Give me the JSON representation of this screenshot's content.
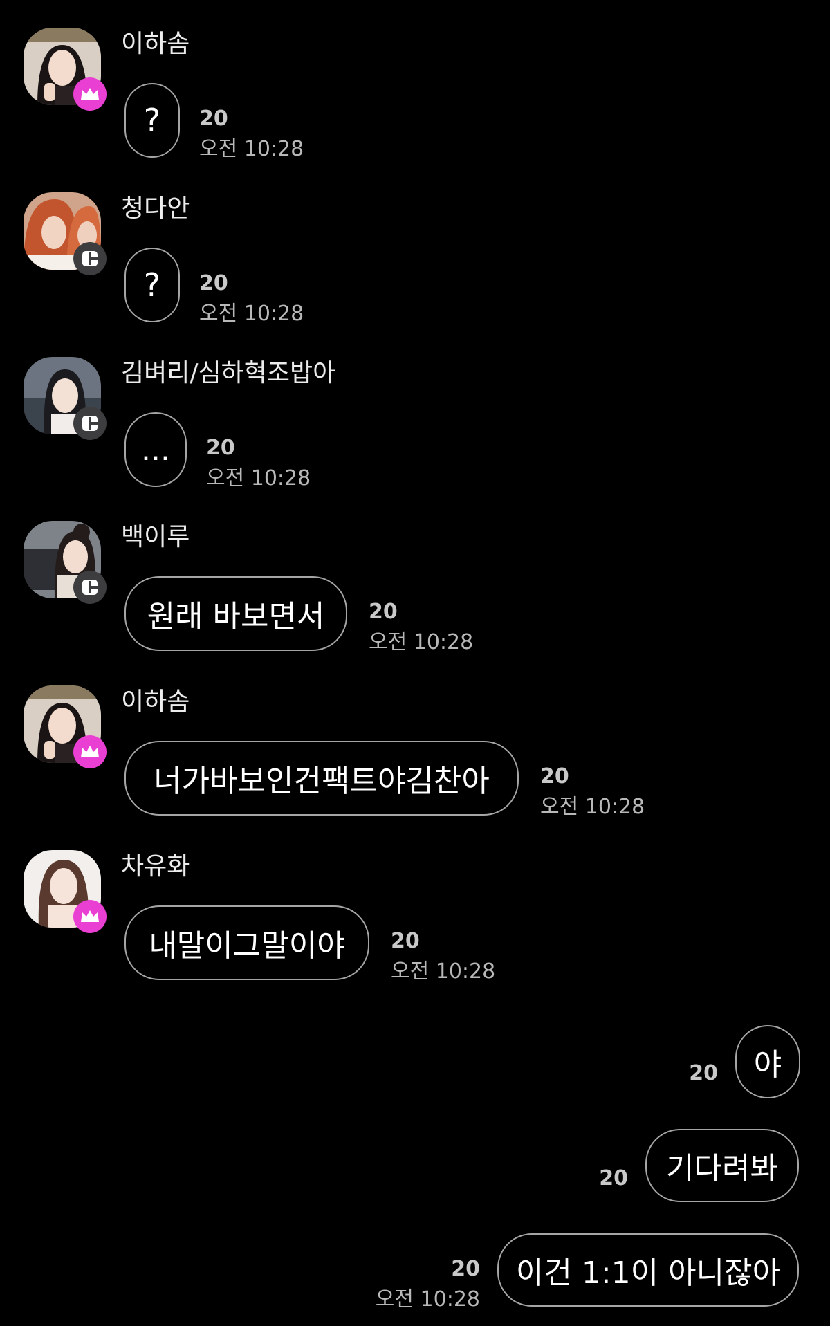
{
  "messages": [
    {
      "sender": "이하솜",
      "text": "?",
      "unread": "20",
      "time": "오전 10:28",
      "badge": "crown"
    },
    {
      "sender": "청다안",
      "text": "?",
      "unread": "20",
      "time": "오전 10:28",
      "badge": "manager"
    },
    {
      "sender": "김벼리/심하혁조밥아",
      "text": "...",
      "unread": "20",
      "time": "오전 10:28",
      "badge": "manager"
    },
    {
      "sender": "백이루",
      "text": "원래 바보면서",
      "unread": "20",
      "time": "오전 10:28",
      "badge": "manager"
    },
    {
      "sender": "이하솜",
      "text": "너가바보인건팩트야김찬아",
      "unread": "20",
      "time": "오전 10:28",
      "badge": "crown"
    },
    {
      "sender": "차유화",
      "text": "내말이그말이야",
      "unread": "20",
      "time": "오전 10:28",
      "badge": "crown"
    }
  ],
  "my_messages": [
    {
      "text": "야",
      "unread": "20"
    },
    {
      "text": "기다려봐",
      "unread": "20"
    },
    {
      "text": "이건 1:1이 아니잖아",
      "unread": "20",
      "time": "오전 10:28"
    }
  ],
  "colors": {
    "background": "#000000",
    "crown_badge": "#ea3fd3",
    "manager_badge": "#3d3d3f",
    "bubble_border": "#a5a5a5"
  },
  "icons": {
    "crown_badge": "crown-icon",
    "manager_badge": "manager-icon"
  }
}
